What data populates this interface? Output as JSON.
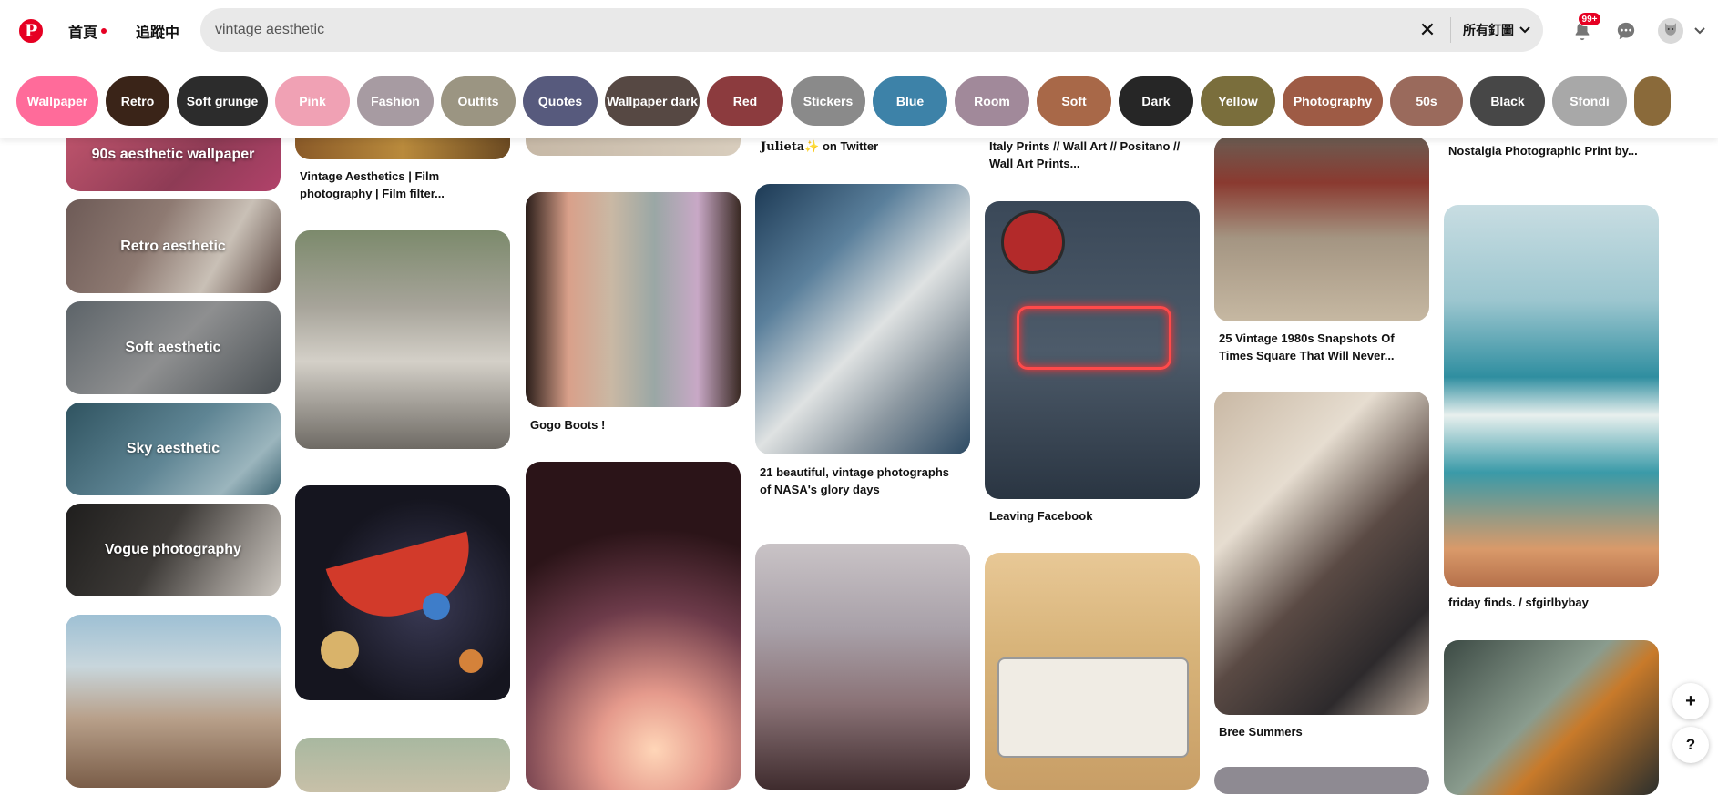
{
  "header": {
    "logo_letter": "P",
    "nav_home": "首頁",
    "nav_following": "追蹤中",
    "search_value": "vintage aesthetic",
    "clear_symbol": "✕",
    "search_scope": "所有釘圖",
    "scope_chevron": "⌄",
    "notifications_badge": "99+",
    "bell_icon": "🔔",
    "messages_icon": "💬",
    "avatar_icon": "🐱",
    "account_chevron": "⌄"
  },
  "chips": [
    {
      "label": "Wallpaper",
      "color": "#ff6b9a"
    },
    {
      "label": "Retro",
      "color": "#3a2418"
    },
    {
      "label": "Soft grunge",
      "color": "#2c2c2c"
    },
    {
      "label": "Pink",
      "color": "#f0a1b4"
    },
    {
      "label": "Fashion",
      "color": "#a79ba2"
    },
    {
      "label": "Outfits",
      "color": "#9b9582"
    },
    {
      "label": "Quotes",
      "color": "#575a7d"
    },
    {
      "label": "Wallpaper dark",
      "color": "#564843"
    },
    {
      "label": "Red",
      "color": "#8c3b3e"
    },
    {
      "label": "Stickers",
      "color": "#8a8a8a"
    },
    {
      "label": "Blue",
      "color": "#3d82a8"
    },
    {
      "label": "Room",
      "color": "#a1899a"
    },
    {
      "label": "Soft",
      "color": "#a86848"
    },
    {
      "label": "Dark",
      "color": "#262626"
    },
    {
      "label": "Yellow",
      "color": "#7a6e3c"
    },
    {
      "label": "Photography",
      "color": "#9e5b45"
    },
    {
      "label": "50s",
      "color": "#9a6a5c"
    },
    {
      "label": "Black",
      "color": "#474747"
    },
    {
      "label": "Sfondi",
      "color": "#a8a8a8"
    },
    {
      "label": "",
      "color": "#8a6a3a"
    }
  ],
  "col1": {
    "cat1": "90s aesthetic wallpaper",
    "cat2": "Retro aesthetic",
    "cat3": "Soft aesthetic",
    "cat4": "Sky aesthetic",
    "cat5": "Vogue photography"
  },
  "captions": {
    "c2_1": "Vintage Aesthetics | Film photography | Film filter...",
    "c3_1": "Gogo Boots !",
    "c4_0_name": "Julieta",
    "c4_0_emoji": "✨",
    "c4_0_rest": " on Twitter",
    "c4_1": "21 beautiful, vintage photographs of NASA's glory days",
    "c5_0": "Italy Prints // Wall Art // Positano // Wall Art Prints...",
    "c5_1": "Leaving Facebook",
    "c6_1": "25 Vintage 1980s Snapshots Of Times Square That Will Never...",
    "c6_2": "Bree Summers",
    "c7_0": "Nostalgia Photographic Print by...",
    "c7_1": "friday finds. / sfgirlbybay"
  },
  "fab": {
    "plus": "+",
    "help": "?"
  }
}
